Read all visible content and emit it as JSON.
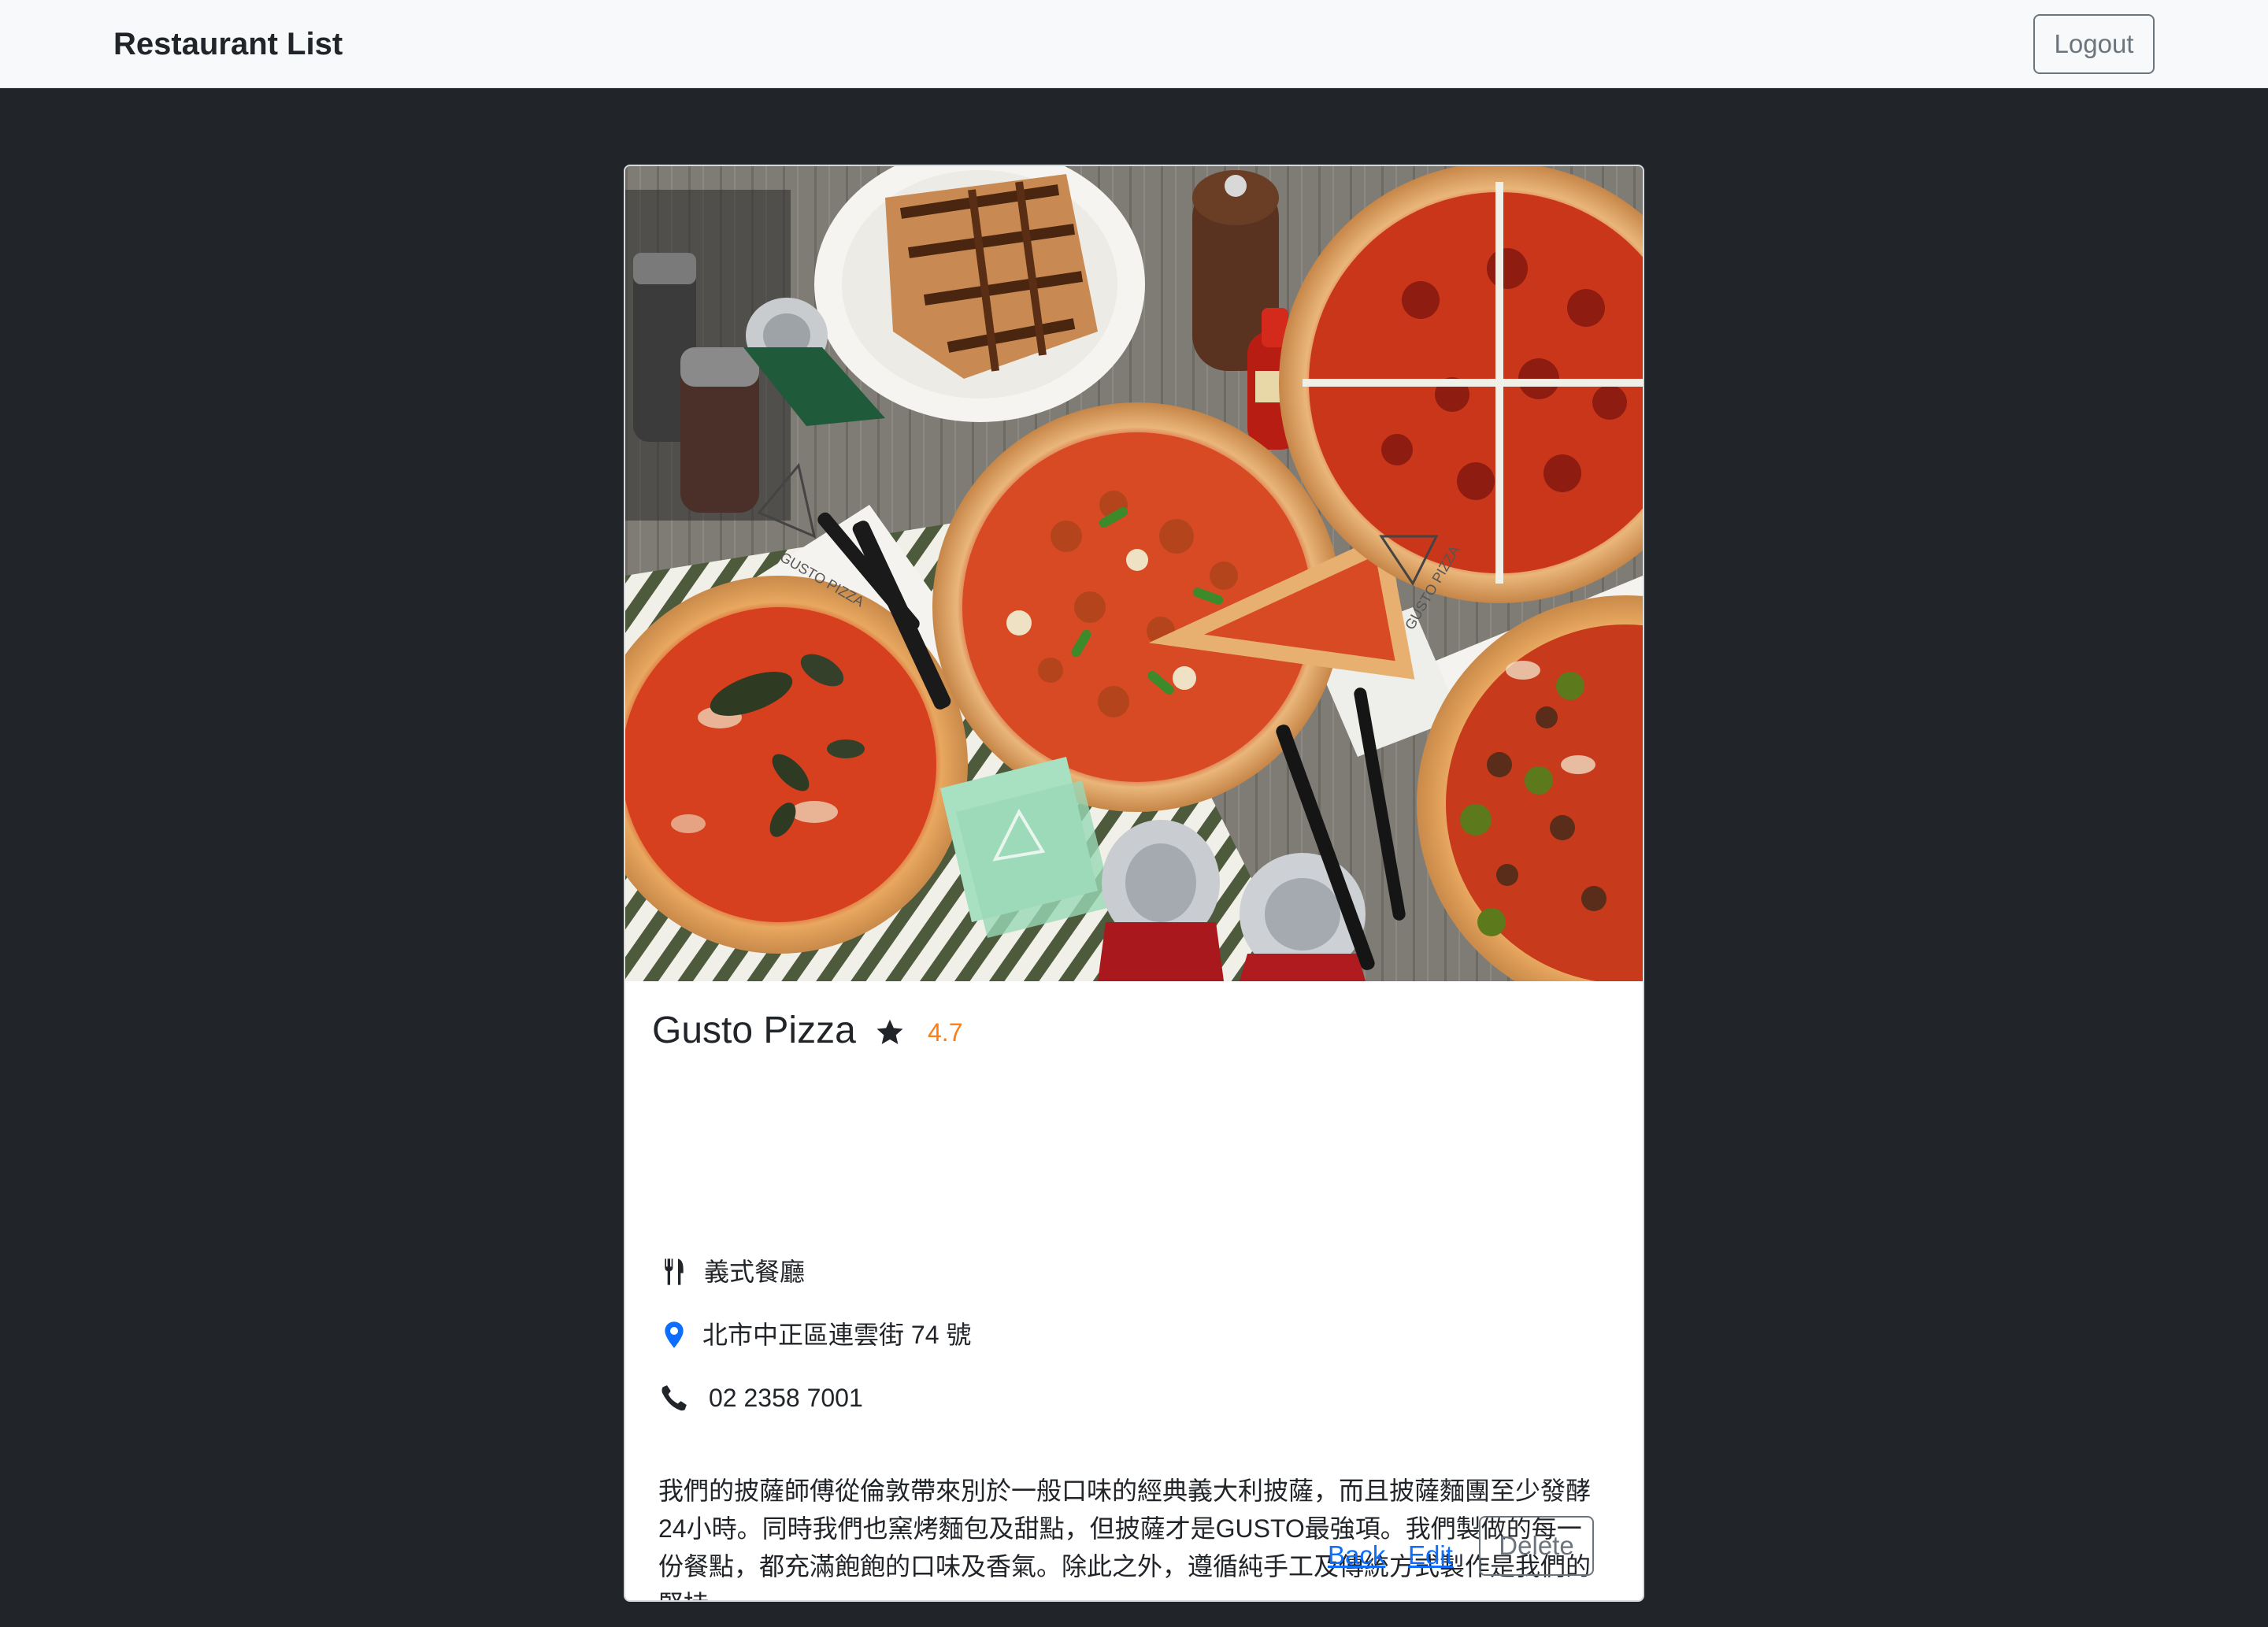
{
  "navbar": {
    "brand": "Restaurant List",
    "logout_label": "Logout"
  },
  "restaurant": {
    "name": "Gusto Pizza",
    "rating": "4.7",
    "category": "義式餐廳",
    "address": "北市中正區連雲街 74 號",
    "phone": "02 2358 7001",
    "description": "我們的披薩師傅從倫敦帶來別於一般口味的經典義大利披薩，而且披薩麵團至少發酵24小時。同時我們也窯烤麵包及甜點，但披薩才是GUSTO最強項。我們製做的每一份餐點，都充滿飽飽的口味及香氣。除此之外，遵循純手工及傳統方式製作是我們的堅持。",
    "photo_brand_text": "GUSTO PIZZA"
  },
  "actions": {
    "back_label": "Back",
    "edit_label": "Edit",
    "delete_label": "Delete"
  },
  "icons": {
    "rating": "star-icon",
    "category": "utensils-icon",
    "address": "map-pin-icon",
    "phone": "phone-icon"
  },
  "colors": {
    "page_background": "#212529",
    "navbar_background": "#f8f9fa",
    "rating": "#fd7e14",
    "link": "#0d6efd",
    "map_pin": "#0d6efd",
    "secondary_button": "#6c757d"
  }
}
